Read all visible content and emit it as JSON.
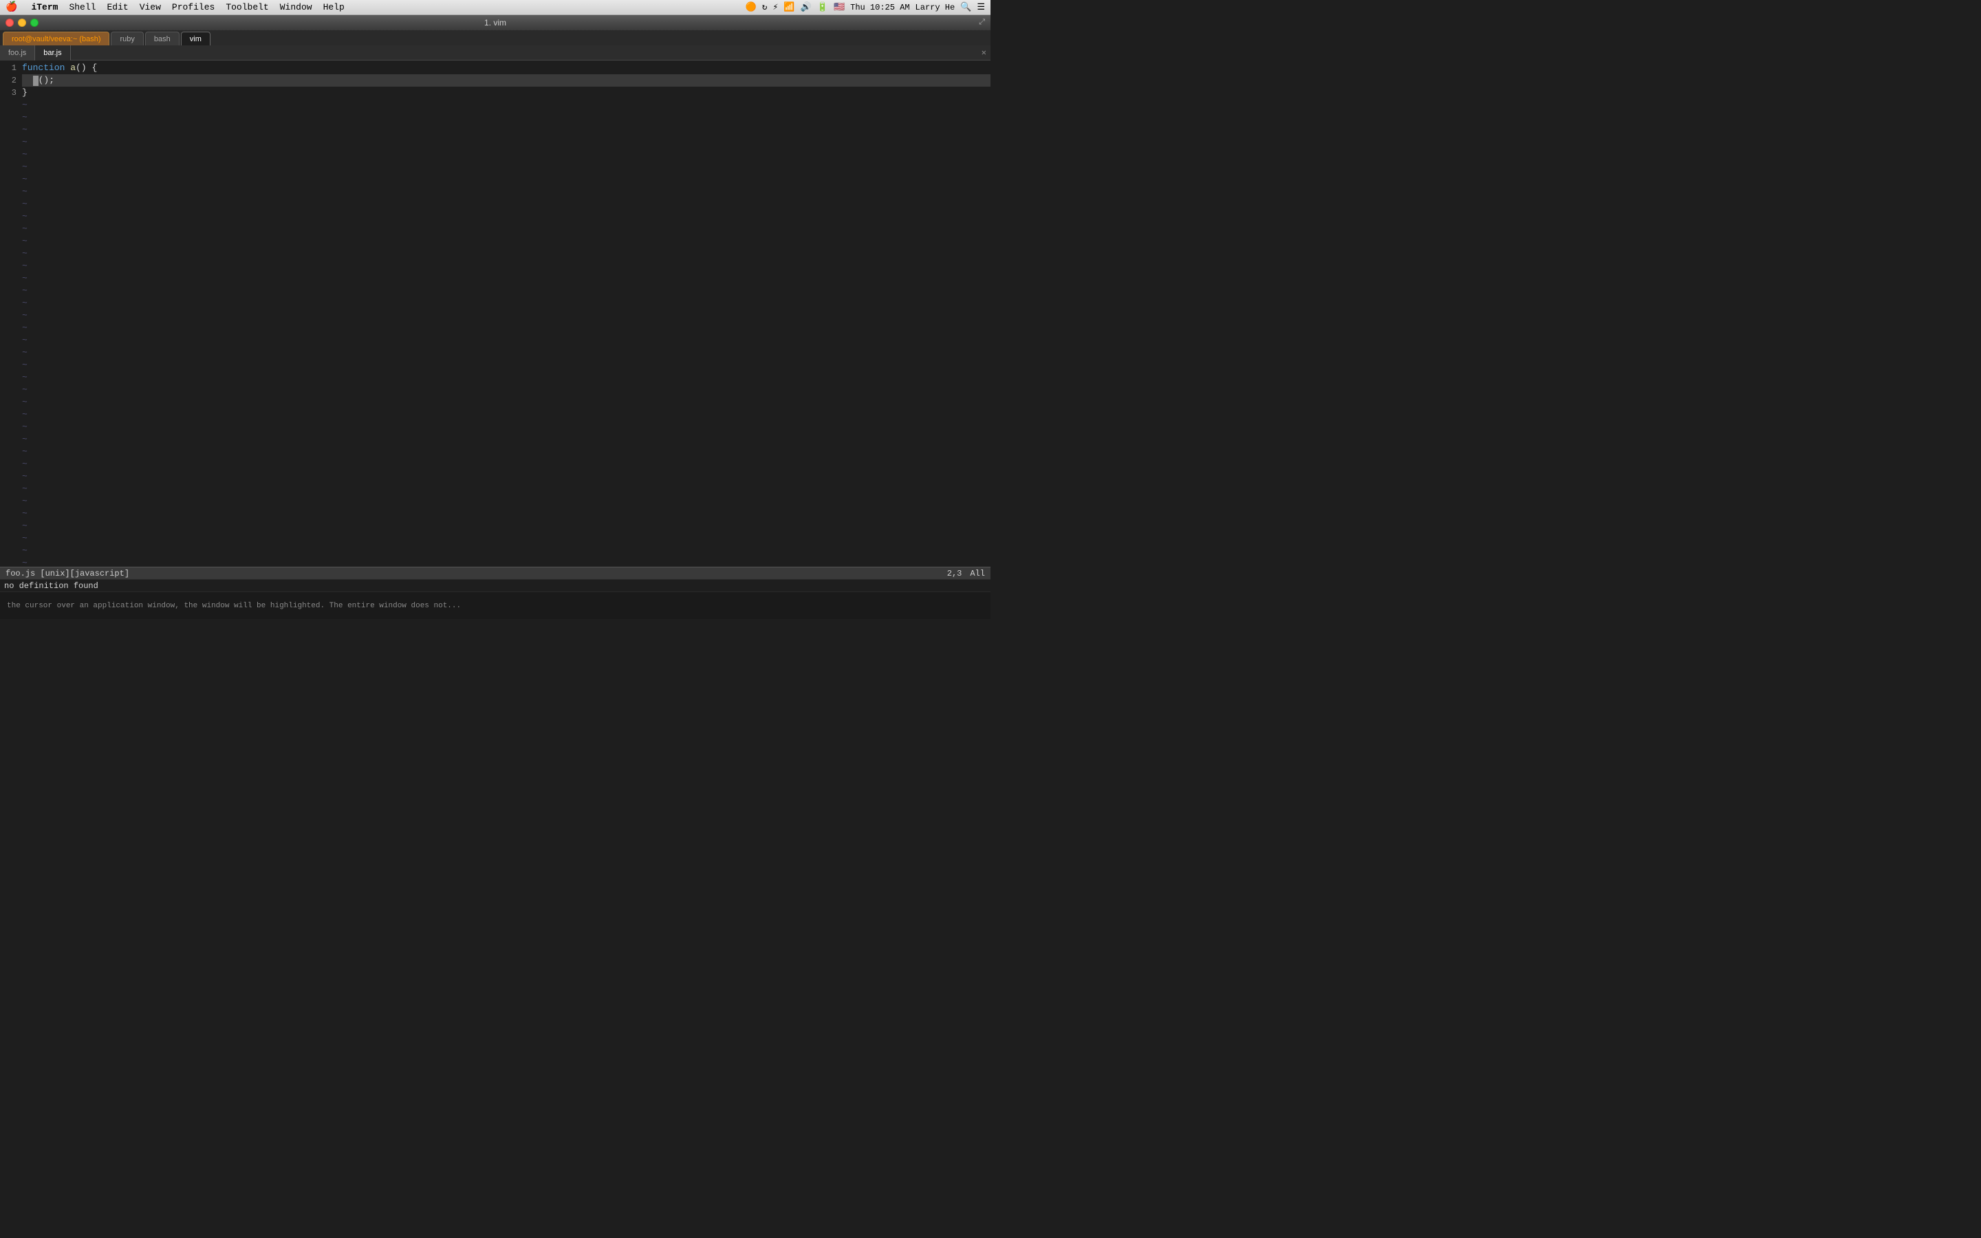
{
  "menubar": {
    "apple": "🍎",
    "app_name": "iTerm",
    "items": [
      "Shell",
      "Edit",
      "View",
      "Profiles",
      "Toolbelt",
      "Window",
      "Help"
    ],
    "time": "Thu 10:25 AM",
    "user": "Larry He",
    "icons": [
      "🔍",
      "☰"
    ]
  },
  "title_bar": {
    "title": "1. vim",
    "expand_icon": "⤢"
  },
  "window_controls": {
    "close": "close",
    "minimize": "minimize",
    "maximize": "maximize"
  },
  "session_tabs": [
    {
      "label": "root@vault/veeva:~ (bash)",
      "active": true,
      "style": "bash"
    },
    {
      "label": "ruby",
      "active": false
    },
    {
      "label": "bash",
      "active": false
    },
    {
      "label": "vim",
      "active": true
    }
  ],
  "buffer_tabs": [
    {
      "label": "foo.js",
      "active": false
    },
    {
      "label": "bar.js",
      "active": true
    }
  ],
  "code": {
    "lines": [
      {
        "num": "1",
        "content": "function a() {",
        "type": "code"
      },
      {
        "num": "2",
        "content": "  b();",
        "type": "code",
        "highlighted": true,
        "cursor": true
      },
      {
        "num": "3",
        "content": "}",
        "type": "code"
      }
    ],
    "tildes": 40
  },
  "status": {
    "file": "foo.js [unix][javascript]",
    "position": "2,3",
    "scroll": "All"
  },
  "command_line": {
    "text": "no definition found"
  },
  "bottom_bar": {
    "text": "the cursor over an application window, the window will be highlighted. The entire window does not..."
  }
}
